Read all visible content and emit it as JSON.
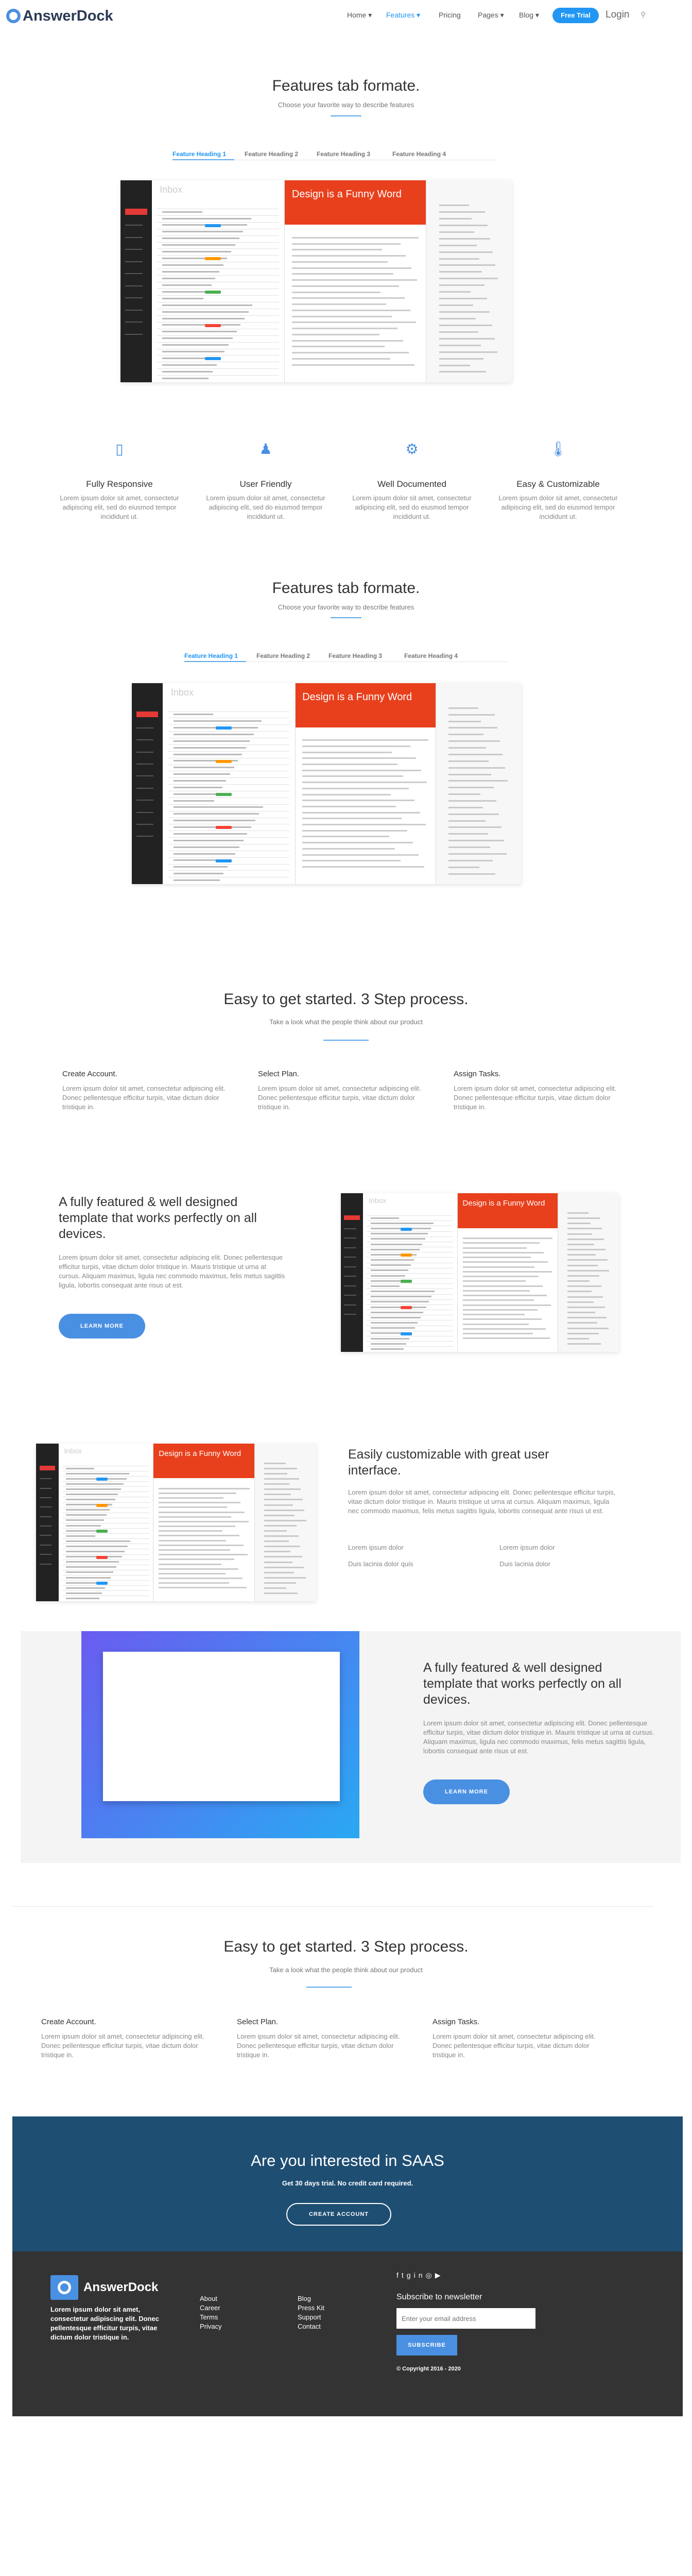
{
  "header": {
    "logo_text": "AnswerDock",
    "nav": [
      {
        "label": "Home ▾",
        "active": false
      },
      {
        "label": "Features ▾",
        "active": true
      },
      {
        "label": "Pricing",
        "active": false
      },
      {
        "label": "Pages ▾",
        "active": false
      },
      {
        "label": "Blog ▾",
        "active": false
      }
    ],
    "trial_label": "Free Trial",
    "login_label": "Login",
    "search_icon": "search-icon"
  },
  "features_tab_1": {
    "title": "Features tab formate.",
    "subtitle": "Choose your favorite way to describe features",
    "tabs": [
      "Feature Heading 1",
      "Feature Heading 2",
      "Feature Heading 3",
      "Feature Heading 4"
    ]
  },
  "mock_app": {
    "inbox_label": "Inbox",
    "email_heading": "Design is a Funny Word"
  },
  "features": [
    {
      "icon": "mobile-icon",
      "title": "Fully Responsive",
      "text": "Lorem ipsum dolor sit amet, consectetur adipiscing elit, sed do eiusmod tempor incididunt ut."
    },
    {
      "icon": "user-icon",
      "title": "User Friendly",
      "text": "Lorem ipsum dolor sit amet, consectetur adipiscing elit, sed do eiusmod tempor incididunt ut."
    },
    {
      "icon": "gear-icon",
      "title": "Well Documented",
      "text": "Lorem ipsum dolor sit amet, consectetur adipiscing elit, sed do eiusmod tempor incididunt ut."
    },
    {
      "icon": "thermometer-icon",
      "title": "Easy & Customizable",
      "text": "Lorem ipsum dolor sit amet, consectetur adipiscing elit, sed do eiusmod tempor incididunt ut."
    }
  ],
  "features_tab_2": {
    "title": "Features tab formate.",
    "subtitle": "Choose your favorite way to describe features",
    "tabs": [
      "Feature Heading 1",
      "Feature Heading 2",
      "Feature Heading 3",
      "Feature Heading 4"
    ]
  },
  "steps_1": {
    "title": "Easy to get started. 3 Step process.",
    "subtitle": "Take a look what the people think about our product",
    "items": [
      {
        "title": "Create Account.",
        "text": "Lorem ipsum dolor sit amet, consectetur adipiscing elit. Donec pellentesque efficitur turpis, vitae dictum dolor tristique in."
      },
      {
        "title": "Select Plan.",
        "text": "Lorem ipsum dolor sit amet, consectetur adipiscing elit. Donec pellentesque efficitur turpis, vitae dictum dolor tristique in."
      },
      {
        "title": "Assign Tasks.",
        "text": "Lorem ipsum dolor sit amet, consectetur adipiscing elit. Donec pellentesque efficitur turpis, vitae dictum dolor tristique in."
      }
    ]
  },
  "block_1": {
    "title": "A fully featured & well designed template that works perfectly on all devices.",
    "text": "Lorem ipsum dolor sit amet, consectetur adipiscing elit. Donec pellentesque efficitur turpis, vitae dictum dolor tristique in. Mauris tristique ut urna at cursus. Aliquam maximus, ligula nec commodo maximus, felis metus sagittis ligula, lobortis consequat ante risus ut est.",
    "button": "LEARN MORE"
  },
  "block_2": {
    "title": "Easily customizable with great user interface.",
    "text": "Lorem ipsum dolor sit amet, consectetur adipiscing elit. Donec pellentesque efficitur turpis, vitae dictum dolor tristique in. Mauris tristique ut urna at cursus. Aliquam maximus, ligula nec commodo maximus, felis metus sagittis ligula, lobortis consequat ante risus ut est.",
    "bullets": [
      "Lorem ipsum dolor",
      "Lorem ipsum dolor",
      "Duis lacinia dolor quis",
      "Duis lacinia dolor"
    ]
  },
  "block_3": {
    "title": "A fully featured & well designed template that works perfectly on all devices.",
    "text": "Lorem ipsum dolor sit amet, consectetur adipiscing elit. Donec pellentesque efficitur turpis, vitae dictum dolor tristique in. Mauris tristique ut urna at cursus. Aliquam maximus, ligula nec commodo maximus, felis metus sagittis ligula, lobortis consequat ante risus ut est.",
    "button": "LEARN MORE"
  },
  "steps_2": {
    "title": "Easy to get started. 3 Step process.",
    "subtitle": "Take a look what the people think about our product",
    "items": [
      {
        "title": "Create Account.",
        "text": "Lorem ipsum dolor sit amet, consectetur adipiscing elit. Donec pellentesque efficitur turpis, vitae dictum dolor tristique in."
      },
      {
        "title": "Select Plan.",
        "text": "Lorem ipsum dolor sit amet, consectetur adipiscing elit. Donec pellentesque efficitur turpis, vitae dictum dolor tristique in."
      },
      {
        "title": "Assign Tasks.",
        "text": "Lorem ipsum dolor sit amet, consectetur adipiscing elit. Donec pellentesque efficitur turpis, vitae dictum dolor tristique in."
      }
    ]
  },
  "cta": {
    "title": "Are you interested in SAAS",
    "subtitle": "Get 30 days trial. No credit card required.",
    "button": "CREATE ACCOUNT"
  },
  "footer": {
    "logo_text": "AnswerDock",
    "about": "Lorem ipsum dolor sit amet, consectetur adipiscing elit. Donec pellentesque efficitur turpis, vitae dictum dolor tristique in.",
    "col1": [
      "About",
      "Career",
      "Terms",
      "Privacy"
    ],
    "col2": [
      "Blog",
      "Press Kit",
      "Support",
      "Contact"
    ],
    "social_icons": [
      "facebook-icon",
      "twitter-icon",
      "google-plus-icon",
      "linkedin-icon",
      "rss-icon",
      "youtube-icon"
    ],
    "newsletter_title": "Subscribe to newsletter",
    "email_placeholder": "Enter your email address",
    "subscribe_label": "SUBSCRIBE",
    "copyright": "© Copyright 2016 - 2020"
  }
}
